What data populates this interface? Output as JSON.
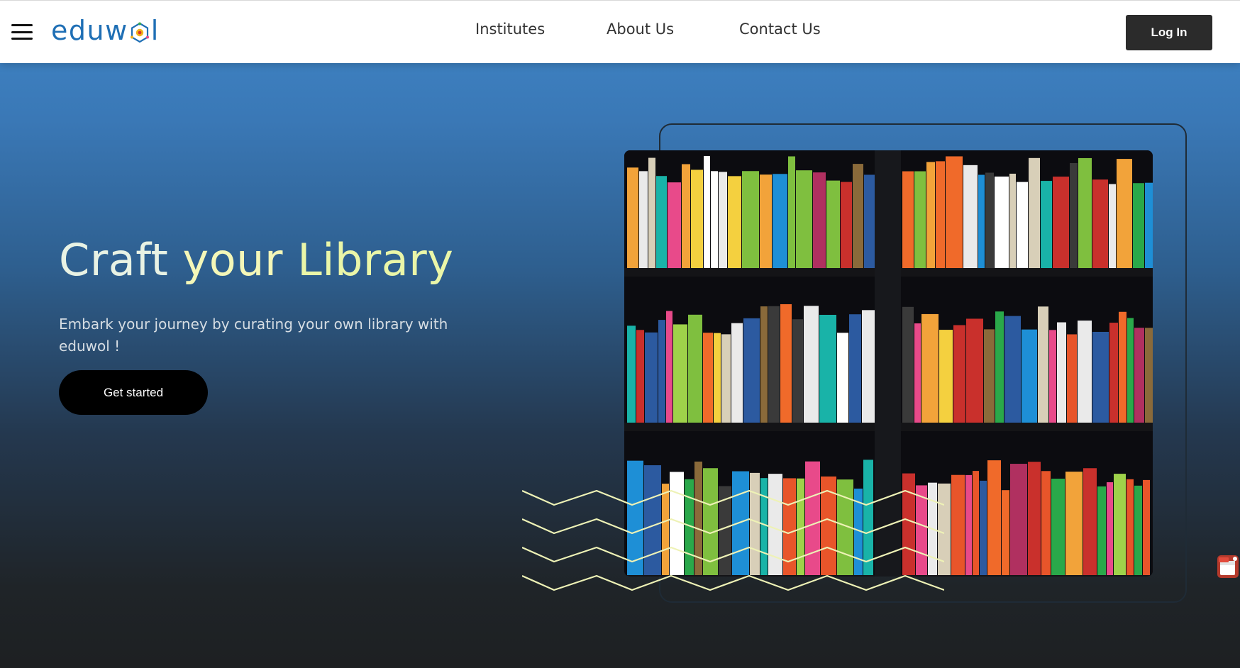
{
  "nav": {
    "logo_text": "eduwl",
    "logo_before": "edu",
    "logo_w": "w",
    "logo_after": "l",
    "links": [
      "Institutes",
      "About Us",
      "Contact Us"
    ],
    "login_label": "Log In"
  },
  "hero": {
    "title_word1": "Craft",
    "title_word2": "your",
    "title_word3": "Library",
    "subtitle": "Embark your journey by curating your own library with eduwol !",
    "cta_label": "Get started"
  },
  "image": {
    "alt": "Colorful bookshelf"
  },
  "colors": {
    "brand": "#1f6fb5",
    "login_bg": "#2b2b2b",
    "cta_bg": "#000000",
    "wave_stroke": "#eef2b6"
  },
  "icons": [
    "hamburger-menu-icon",
    "owl-logo-icon",
    "pdf-icon"
  ]
}
